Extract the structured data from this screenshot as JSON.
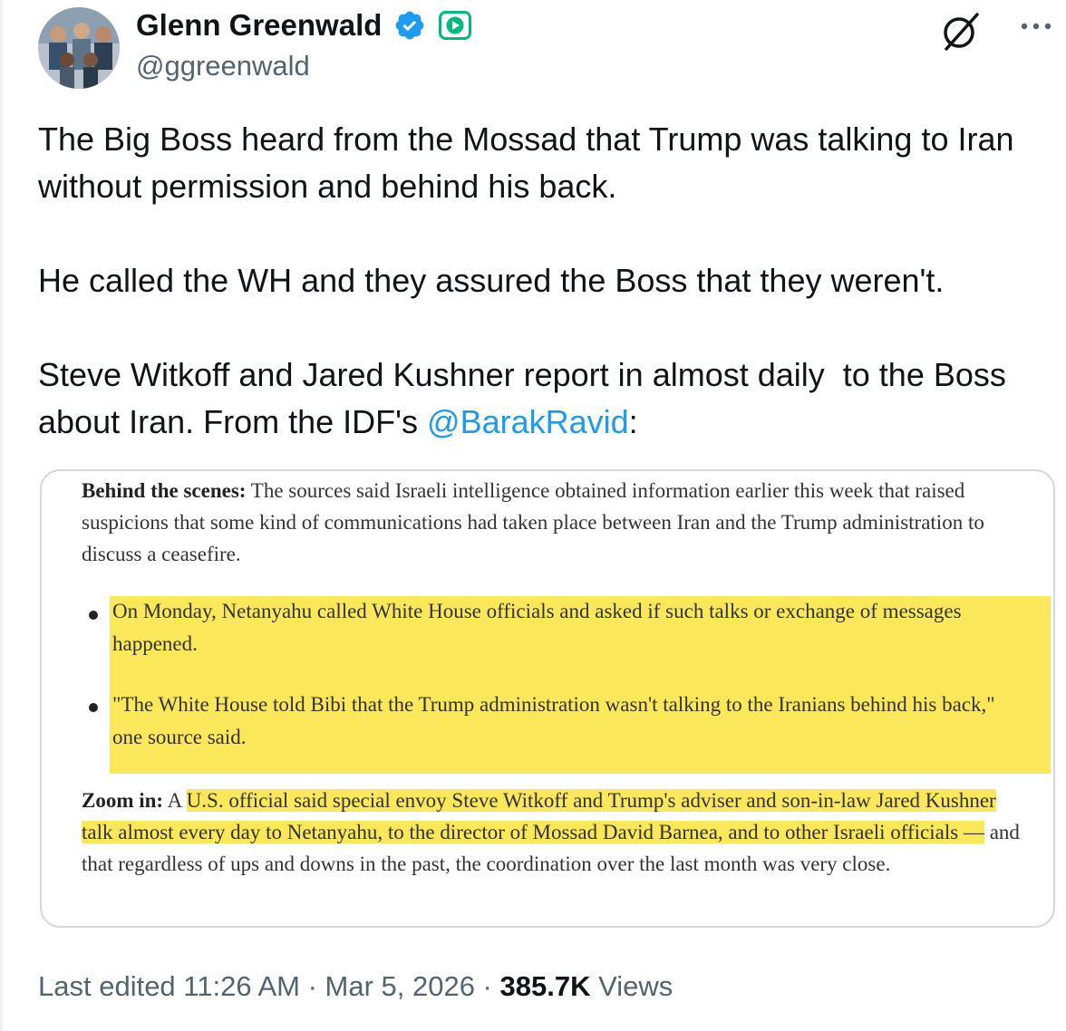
{
  "author": {
    "name": "Glenn Greenwald",
    "handle": "@ggreenwald"
  },
  "tweet": {
    "paragraph1": "The Big Boss heard from the Mossad that Trump was talking to Iran without permission and behind his back.",
    "paragraph2": "He called the WH and they assured the Boss that they weren't.",
    "paragraph3_prefix": "Steve Witkoff and Jared Kushner report in almost daily  to the Boss about Iran. From the IDF's ",
    "mention": "@BarakRavid",
    "paragraph3_suffix": ":"
  },
  "quoted_article": {
    "lead_label": "Behind the scenes:",
    "lead_text": " The sources said Israeli intelligence obtained information earlier this week that raised suspicions that some kind of communications had taken place between Iran and the Trump administration to discuss a ceasefire.",
    "bullet1": "On Monday, Netanyahu called White House officials and asked if such talks or exchange of messages happened.",
    "bullet2": "\"The White House told Bibi that the Trump administration wasn't talking to the Iranians behind his back,\" one source said.",
    "zoom_label": "Zoom in:",
    "zoom_prefix": " A ",
    "zoom_highlight": "U.S. official said special envoy Steve Witkoff and Trump's adviser and son-in-law Jared Kushner talk almost every day to Netanyahu, to the director of Mossad David Barnea, and to other Israeli officials —",
    "zoom_rest": " and that regardless of ups and downs in the past, the coordination over the last month was very close."
  },
  "footer": {
    "edited_label": "Last edited 11:26 AM · Mar 5, 2026 · ",
    "views_count": "385.7K",
    "views_label": " Views"
  },
  "colors": {
    "link": "#1d9bf0",
    "verified": "#1d9bf0",
    "subscription_badge": "#00ba7c",
    "highlight": "#fbe85a",
    "secondary_text": "#536471"
  },
  "icons": [
    "verified-badge-icon",
    "subscription-badge-icon",
    "grok-icon",
    "more-icon"
  ]
}
